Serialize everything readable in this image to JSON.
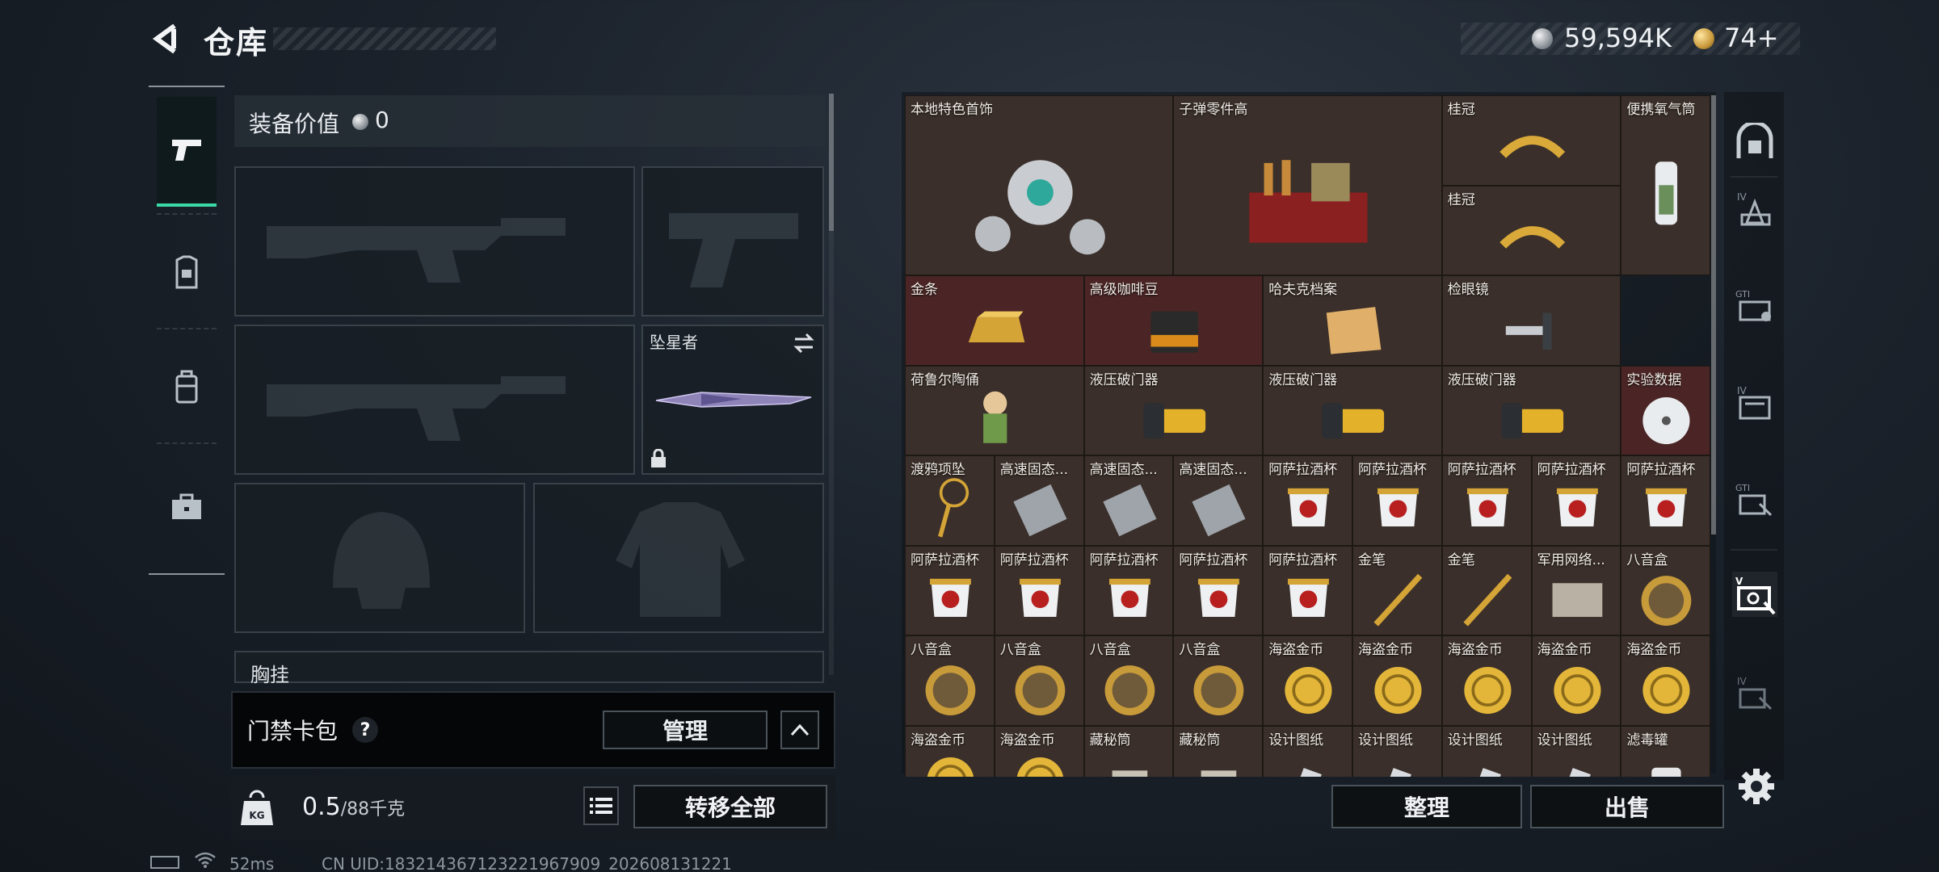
{
  "header": {
    "title": "仓库",
    "currency_silver": "59,594K",
    "currency_gold": "74+"
  },
  "equipment": {
    "value_label": "装备价值",
    "value": "0",
    "melee_name": "坠星者",
    "chest_label": "胸挂"
  },
  "keycard": {
    "label": "门禁卡包",
    "help": "?",
    "manage_label": "管理"
  },
  "capacity": {
    "current": "0.5",
    "max_unit": "/88千克",
    "kg_badge": "KG",
    "transfer_label": "转移全部"
  },
  "actions": {
    "sort_label": "整理",
    "sell_label": "出售"
  },
  "status": {
    "ping": "52ms",
    "uid": "CN UID:183214367123221967909_202608131221"
  },
  "warehouse": {
    "items": [
      {
        "name": "本地特色首饰",
        "icon": "jewelry-icon"
      },
      {
        "name": "子弹零件高",
        "icon": "ammo-parts-icon"
      },
      {
        "name": "桂冠",
        "icon": "laurel-icon"
      },
      {
        "name": "便携氧气筒",
        "icon": "oxygen-tank-icon"
      },
      {
        "name": "桂冠",
        "icon": "laurel-icon"
      },
      {
        "name": "金条",
        "icon": "gold-bar-icon"
      },
      {
        "name": "高级咖啡豆",
        "icon": "coffee-bean-icon"
      },
      {
        "name": "哈夫克档案",
        "icon": "dossier-icon"
      },
      {
        "name": "检眼镜",
        "icon": "ophthalmoscope-icon"
      },
      {
        "name": "荷鲁尔陶俑",
        "icon": "figurine-icon"
      },
      {
        "name": "液压破门器",
        "icon": "hydraulic-breacher-icon"
      },
      {
        "name": "液压破门器",
        "icon": "hydraulic-breacher-icon"
      },
      {
        "name": "液压破门器",
        "icon": "hydraulic-breacher-icon"
      },
      {
        "name": "实验数据",
        "icon": "data-disc-icon"
      },
      {
        "name": "渡鸦项坠",
        "icon": "pendant-icon"
      },
      {
        "name": "高速固态...",
        "icon": "ssd-icon"
      },
      {
        "name": "高速固态...",
        "icon": "ssd-icon"
      },
      {
        "name": "高速固态...",
        "icon": "ssd-icon"
      },
      {
        "name": "阿萨拉酒杯",
        "icon": "goblet-icon"
      },
      {
        "name": "阿萨拉酒杯",
        "icon": "goblet-icon"
      },
      {
        "name": "阿萨拉酒杯",
        "icon": "goblet-icon"
      },
      {
        "name": "阿萨拉酒杯",
        "icon": "goblet-icon"
      },
      {
        "name": "阿萨拉酒杯",
        "icon": "goblet-icon"
      },
      {
        "name": "阿萨拉酒杯",
        "icon": "goblet-icon"
      },
      {
        "name": "阿萨拉酒杯",
        "icon": "goblet-icon"
      },
      {
        "name": "阿萨拉酒杯",
        "icon": "goblet-icon"
      },
      {
        "name": "阿萨拉酒杯",
        "icon": "goblet-icon"
      },
      {
        "name": "阿萨拉酒杯",
        "icon": "goblet-icon"
      },
      {
        "name": "金笔",
        "icon": "gold-pen-icon"
      },
      {
        "name": "金笔",
        "icon": "gold-pen-icon"
      },
      {
        "name": "军用网络...",
        "icon": "network-module-icon"
      },
      {
        "name": "八音盒",
        "icon": "music-box-icon"
      },
      {
        "name": "八音盒",
        "icon": "music-box-icon"
      },
      {
        "name": "八音盒",
        "icon": "music-box-icon"
      },
      {
        "name": "八音盒",
        "icon": "music-box-icon"
      },
      {
        "name": "八音盒",
        "icon": "music-box-icon"
      },
      {
        "name": "海盗金币",
        "icon": "pirate-coin-icon"
      },
      {
        "name": "海盗金币",
        "icon": "pirate-coin-icon"
      },
      {
        "name": "海盗金币",
        "icon": "pirate-coin-icon"
      },
      {
        "name": "海盗金币",
        "icon": "pirate-coin-icon"
      },
      {
        "name": "海盗金币",
        "icon": "pirate-coin-icon"
      },
      {
        "name": "海盗金币",
        "icon": "pirate-coin-icon"
      },
      {
        "name": "海盗金币",
        "icon": "pirate-coin-icon"
      },
      {
        "name": "藏秘筒",
        "icon": "cryptex-icon"
      },
      {
        "name": "藏秘筒",
        "icon": "cryptex-icon"
      },
      {
        "name": "设计图纸",
        "icon": "blueprint-icon"
      },
      {
        "name": "设计图纸",
        "icon": "blueprint-icon"
      },
      {
        "name": "设计图纸",
        "icon": "blueprint-icon"
      },
      {
        "name": "设计图纸",
        "icon": "blueprint-icon"
      },
      {
        "name": "滤毒罐",
        "icon": "filter-canister-icon"
      }
    ]
  },
  "colors": {
    "accent": "#3bd9a6",
    "cell_bg": "#3a2f2a",
    "cell_red": "#4b2525"
  }
}
